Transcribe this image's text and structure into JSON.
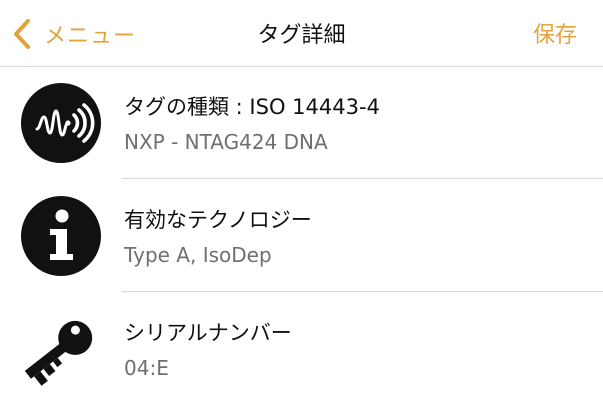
{
  "nav": {
    "back_label": "メニュー",
    "title": "タグ詳細",
    "save_label": "保存",
    "accent_color": "#e3a33c"
  },
  "rows": [
    {
      "icon": "nfc-icon",
      "title": "タグの種類 : ISO 14443-4",
      "subtitle": "NXP - NTAG424 DNA"
    },
    {
      "icon": "info-icon",
      "title": "有効なテクノロジー",
      "subtitle": "Type A, IsoDep"
    },
    {
      "icon": "key-icon",
      "title": "シリアルナンバー",
      "subtitle": "04:E"
    }
  ]
}
